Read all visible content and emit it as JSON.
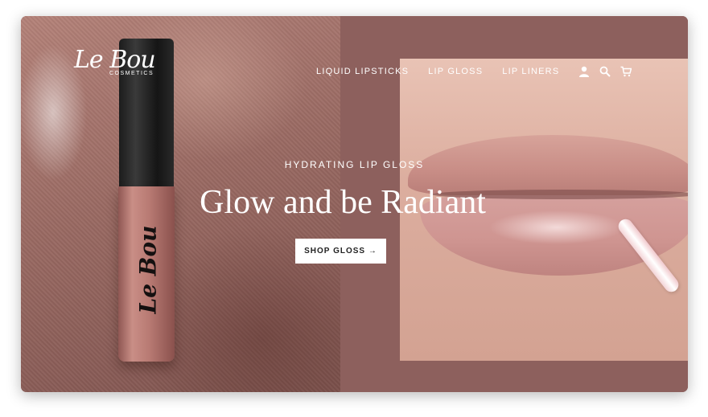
{
  "brand": {
    "logo_text": "Le Bou",
    "logo_subtext": "COSMETICS"
  },
  "nav": {
    "links": [
      "LIQUID LIPSTICKS",
      "LIP GLOSS",
      "LIP LINERS"
    ],
    "icons": [
      "user-icon",
      "search-icon",
      "cart-icon"
    ]
  },
  "hero": {
    "eyebrow": "HYDRATING LIP GLOSS",
    "headline": "Glow and be Radiant",
    "cta_label": "SHOP GLOSS →"
  },
  "product": {
    "tube_logo_text": "Le Bou"
  },
  "colors": {
    "panel_background": "#8d605d",
    "text": "#ffffff",
    "button_background": "#ffffff"
  }
}
